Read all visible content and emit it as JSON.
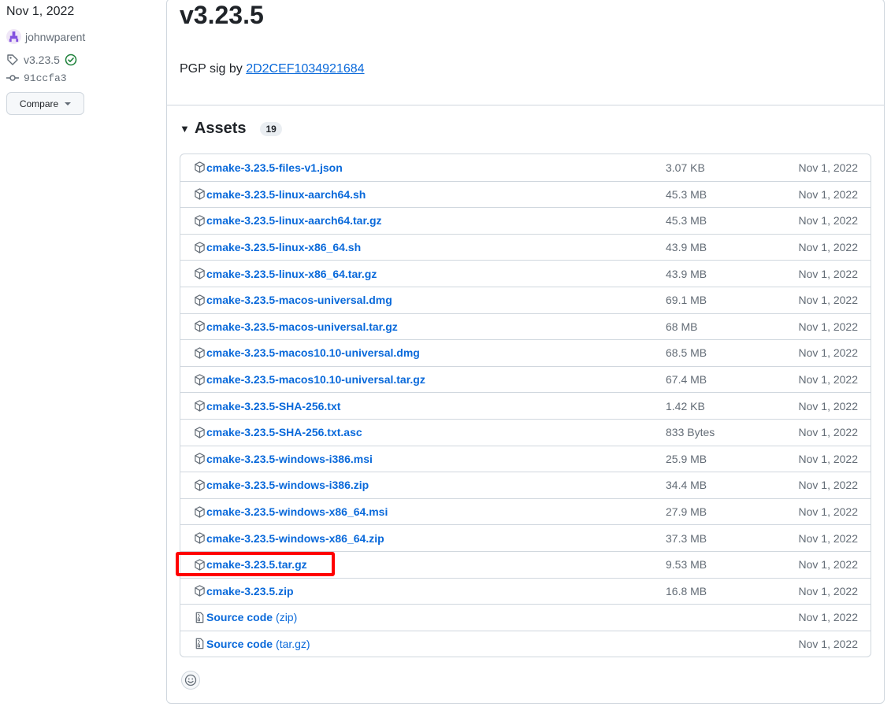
{
  "sidebar": {
    "date": "Nov 1, 2022",
    "author": "johnwparent",
    "tag": "v3.23.5",
    "commit": "91ccfa3",
    "compare_label": "Compare"
  },
  "release": {
    "title": "v3.23.5",
    "pgp_prefix": "PGP sig by",
    "pgp_key": "2D2CEF1034921684"
  },
  "assets": {
    "heading": "Assets",
    "count": "19",
    "items": [
      {
        "name": "cmake-3.23.5-files-v1.json",
        "size": "3.07 KB",
        "date": "Nov 1, 2022"
      },
      {
        "name": "cmake-3.23.5-linux-aarch64.sh",
        "size": "45.3 MB",
        "date": "Nov 1, 2022"
      },
      {
        "name": "cmake-3.23.5-linux-aarch64.tar.gz",
        "size": "45.3 MB",
        "date": "Nov 1, 2022"
      },
      {
        "name": "cmake-3.23.5-linux-x86_64.sh",
        "size": "43.9 MB",
        "date": "Nov 1, 2022"
      },
      {
        "name": "cmake-3.23.5-linux-x86_64.tar.gz",
        "size": "43.9 MB",
        "date": "Nov 1, 2022"
      },
      {
        "name": "cmake-3.23.5-macos-universal.dmg",
        "size": "69.1 MB",
        "date": "Nov 1, 2022"
      },
      {
        "name": "cmake-3.23.5-macos-universal.tar.gz",
        "size": "68 MB",
        "date": "Nov 1, 2022"
      },
      {
        "name": "cmake-3.23.5-macos10.10-universal.dmg",
        "size": "68.5 MB",
        "date": "Nov 1, 2022"
      },
      {
        "name": "cmake-3.23.5-macos10.10-universal.tar.gz",
        "size": "67.4 MB",
        "date": "Nov 1, 2022"
      },
      {
        "name": "cmake-3.23.5-SHA-256.txt",
        "size": "1.42 KB",
        "date": "Nov 1, 2022"
      },
      {
        "name": "cmake-3.23.5-SHA-256.txt.asc",
        "size": "833 Bytes",
        "date": "Nov 1, 2022"
      },
      {
        "name": "cmake-3.23.5-windows-i386.msi",
        "size": "25.9 MB",
        "date": "Nov 1, 2022"
      },
      {
        "name": "cmake-3.23.5-windows-i386.zip",
        "size": "34.4 MB",
        "date": "Nov 1, 2022"
      },
      {
        "name": "cmake-3.23.5-windows-x86_64.msi",
        "size": "27.9 MB",
        "date": "Nov 1, 2022"
      },
      {
        "name": "cmake-3.23.5-windows-x86_64.zip",
        "size": "37.3 MB",
        "date": "Nov 1, 2022"
      },
      {
        "name": "cmake-3.23.5.tar.gz",
        "size": "9.53 MB",
        "date": "Nov 1, 2022"
      },
      {
        "name": "cmake-3.23.5.zip",
        "size": "16.8 MB",
        "date": "Nov 1, 2022"
      }
    ],
    "source_items": [
      {
        "name": "Source code",
        "variant": "(zip)",
        "date": "Nov 1, 2022"
      },
      {
        "name": "Source code",
        "variant": "(tar.gz)",
        "date": "Nov 1, 2022"
      }
    ]
  },
  "colors": {
    "link": "#0969da",
    "muted": "#636c76",
    "border": "#d0d7de",
    "highlight": "#ff0000",
    "verified": "#1a7f37"
  },
  "icons": {
    "package": "package-icon",
    "source": "file-zip-icon",
    "tag": "tag-icon",
    "commit": "git-commit-icon",
    "verified": "verified-icon",
    "smiley": "smiley-icon"
  }
}
